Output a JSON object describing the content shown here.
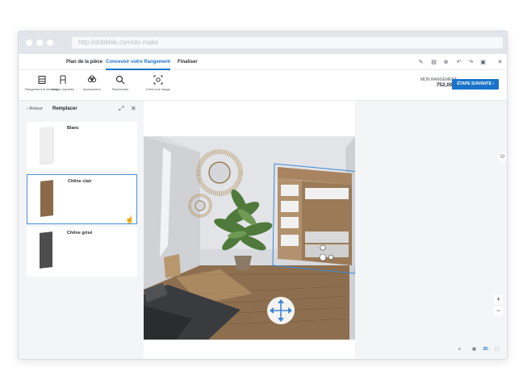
{
  "browser": {
    "url": "http://dribbble.com/do-make"
  },
  "tabs": [
    {
      "label": "Plan de la pièce",
      "active": false
    },
    {
      "label": "Concevoir votre Rangement",
      "active": true
    },
    {
      "label": "Finaliser",
      "active": false
    }
  ],
  "toolbar": {
    "tools": [
      {
        "label": "Rangement et dressing",
        "icon": "cabinet-icon"
      },
      {
        "label": "Autres meubles",
        "icon": "chair-icon"
      },
      {
        "label": "Accessoires",
        "icon": "plant-icon"
      },
      {
        "label": "Rechercher",
        "icon": "search-icon"
      },
      {
        "label": "Créer une image",
        "icon": "camera-icon"
      }
    ],
    "budget_title": "MON RANGEMENT",
    "budget_value": "752,00 €",
    "next_step": "ÉTAPE SUIVANTE ›"
  },
  "panel": {
    "back": "‹  Retour",
    "title": "Remplacer",
    "options": [
      {
        "name": "Blanc",
        "color": "#eeeeee",
        "selected": false
      },
      {
        "name": "Chêne clair",
        "color": "#8a6a48",
        "selected": true
      },
      {
        "name": "Chêne grisé",
        "color": "#4d4d4d",
        "selected": false
      }
    ]
  },
  "view": {
    "zoom_in": "+",
    "zoom_out": "−",
    "modes": [
      "≡",
      "▦",
      "3D",
      "⬚"
    ],
    "active_mode": "3D"
  },
  "colors": {
    "accent": "#1a73c9",
    "selection": "#4d90d6"
  }
}
